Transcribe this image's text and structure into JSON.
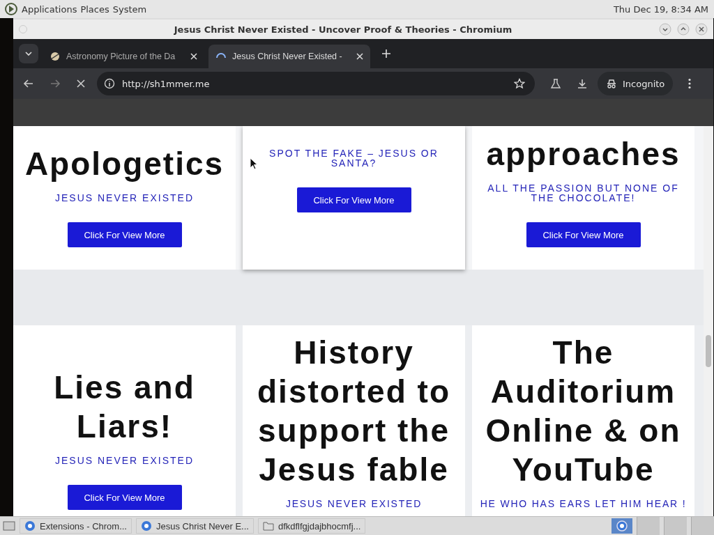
{
  "top_panel": {
    "menus": [
      "Applications",
      "Places",
      "System"
    ],
    "clock": "Thu Dec 19,  8:34 AM"
  },
  "window": {
    "title": "Jesus Christ Never Existed - Uncover Proof & Theories - Chromium"
  },
  "tabs": [
    {
      "label": "Astronomy Picture of the Da",
      "selected": false,
      "kind": "planet"
    },
    {
      "label": "Jesus Christ Never Existed -",
      "selected": true,
      "kind": "loading"
    }
  ],
  "toolbar": {
    "url": "http://sh1mmer.me",
    "loading": true,
    "profile": "Incognito"
  },
  "cards_row_1": [
    {
      "heading": "Apologetics",
      "subtitle": "JESUS NEVER EXISTED",
      "button": "Click For View More",
      "hovered": false
    },
    {
      "subtitle": "SPOT THE FAKE – JESUS OR SANTA?",
      "button": "Click For View More",
      "hovered": true
    },
    {
      "heading": "approaches",
      "subtitle": "ALL THE PASSION BUT NONE OF THE CHOCOLATE!",
      "button": "Click For View More",
      "hovered": false
    }
  ],
  "cards_row_2": [
    {
      "heading": "Lies and Liars!",
      "subtitle": "JESUS NEVER EXISTED",
      "button": "Click For View More"
    },
    {
      "heading": "History distorted to support the Jesus fable",
      "subtitle": "JESUS NEVER EXISTED"
    },
    {
      "heading": "The Auditorium Online & on YouTube",
      "subtitle": "HE WHO HAS EARS LET HIM HEAR !"
    }
  ],
  "taskbar": [
    {
      "label": "Extensions - Chrom...",
      "kind": "browser"
    },
    {
      "label": "Jesus Christ Never E...",
      "kind": "browser"
    },
    {
      "label": "dfkdflfgjdajbhocmfj...",
      "kind": "folder"
    }
  ]
}
